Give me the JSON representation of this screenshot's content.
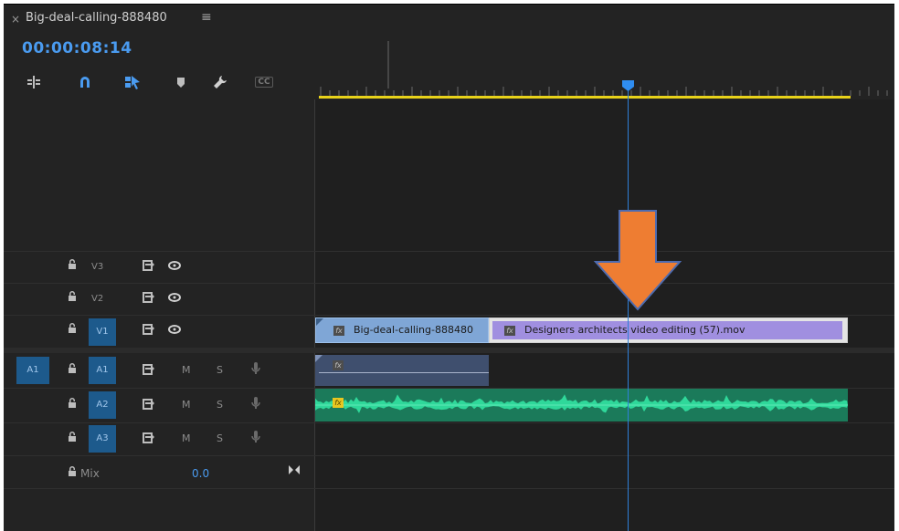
{
  "panel": {
    "close_glyph": "×",
    "title": "Big-deal-calling-888480",
    "menu_glyph": "≡",
    "timecode": "00:00:08:14"
  },
  "toolbar": {
    "tools": [
      "insert-edit-icon",
      "snap-magnet-icon",
      "linked-selection-icon",
      "add-marker-icon",
      "wrench-settings-icon",
      "captions-icon"
    ],
    "captions_label": "CC"
  },
  "tracks": {
    "video": [
      {
        "id": "V3",
        "targeted": false
      },
      {
        "id": "V2",
        "targeted": false
      },
      {
        "id": "V1",
        "targeted": true
      }
    ],
    "audio": [
      {
        "id": "A1",
        "source": "A1",
        "mute": "M",
        "solo": "S"
      },
      {
        "id": "A2",
        "mute": "M",
        "solo": "S"
      },
      {
        "id": "A3",
        "mute": "M",
        "solo": "S"
      }
    ],
    "mix": {
      "label": "Mix",
      "value": "0.0"
    }
  },
  "clips": {
    "v1_a": {
      "name": "Big-deal-calling-888480",
      "fx": "fx"
    },
    "v1_b": {
      "name": "Designers architects video editing (57).mov",
      "fx": "fx"
    },
    "a1": {
      "fx": "fx"
    },
    "a2": {
      "fx": "fx"
    }
  },
  "colors": {
    "accent_blue": "#4a9bf0",
    "work_area": "#e8d21a",
    "video_clip_a": "#7fa6d6",
    "video_clip_b": "#a08fe0",
    "audio_clip": "#2fd89a",
    "arrow": "#ee7d32"
  },
  "icons": {
    "lock": "lock-icon",
    "sync": "sync-lock-icon",
    "eye": "eye-icon",
    "mic": "microphone-icon"
  }
}
